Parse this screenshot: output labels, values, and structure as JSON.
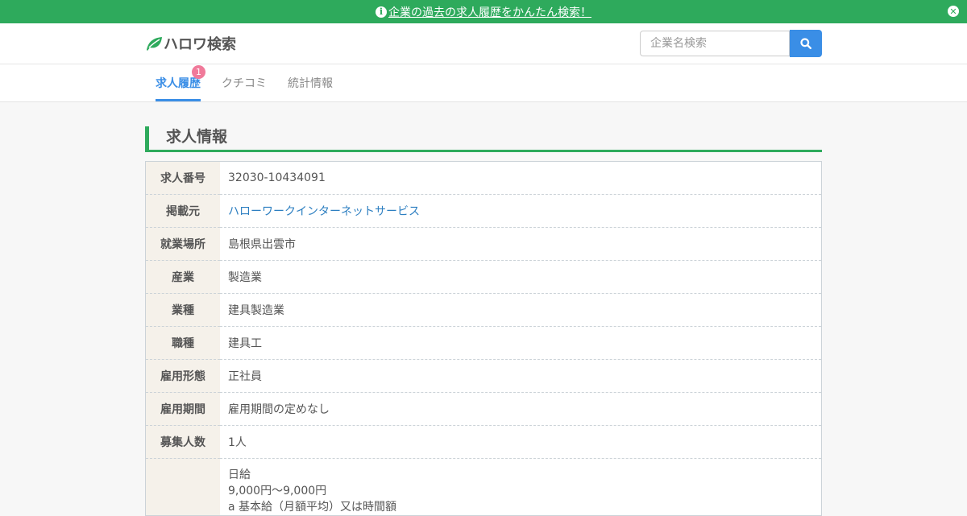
{
  "banner": {
    "text": "企業の過去の求人履歴をかんたん検索！"
  },
  "header": {
    "logo_text": "ハロワ検索",
    "search_placeholder": "企業名検索",
    "brand_color": "#2eaa5c",
    "accent_color": "#3a8ee6"
  },
  "tabs": [
    {
      "label": "求人履歴",
      "active": true,
      "badge": "1"
    },
    {
      "label": "クチコミ",
      "active": false
    },
    {
      "label": "統計情報",
      "active": false
    }
  ],
  "section": {
    "title": "求人情報"
  },
  "rows": [
    {
      "label": "求人番号",
      "value": "32030-10434091"
    },
    {
      "label": "掲載元",
      "value": "ハローワークインターネットサービス",
      "link": true
    },
    {
      "label": "就業場所",
      "value": "島根県出雲市"
    },
    {
      "label": "産業",
      "value": "製造業"
    },
    {
      "label": "業種",
      "value": "建具製造業"
    },
    {
      "label": "職種",
      "value": "建具工"
    },
    {
      "label": "雇用形態",
      "value": "正社員"
    },
    {
      "label": "雇用期間",
      "value": "雇用期間の定めなし"
    },
    {
      "label": "募集人数",
      "value": "1人"
    },
    {
      "label": "",
      "lines": [
        "日給",
        "9,000円～9,000円",
        "a 基本給（月額平均）又は時間額"
      ]
    }
  ]
}
